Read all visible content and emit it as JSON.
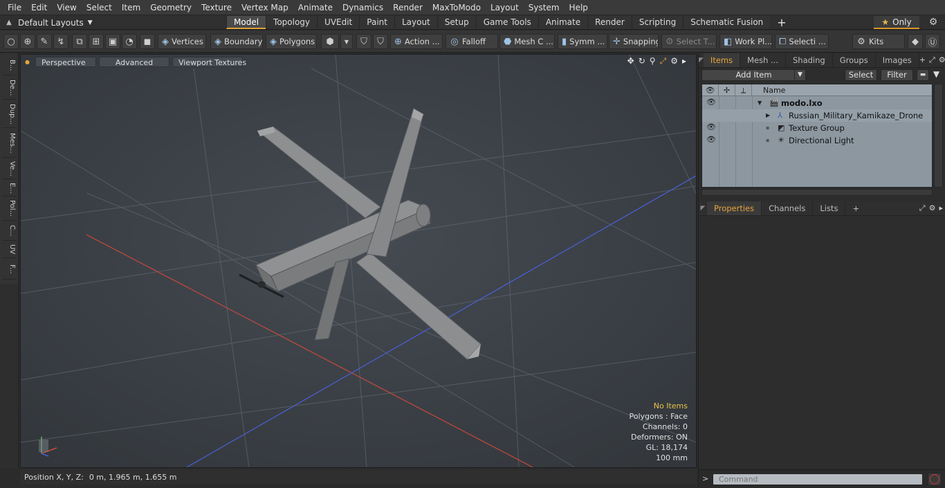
{
  "menu": [
    "File",
    "Edit",
    "View",
    "Select",
    "Item",
    "Geometry",
    "Texture",
    "Vertex Map",
    "Animate",
    "Dynamics",
    "Render",
    "MaxToModo",
    "Layout",
    "System",
    "Help"
  ],
  "layouts_dropdown": "Default Layouts",
  "layout_tabs": [
    "Model",
    "Topology",
    "UVEdit",
    "Paint",
    "Layout",
    "Setup",
    "Game Tools",
    "Animate",
    "Render",
    "Scripting",
    "Schematic Fusion"
  ],
  "active_layout_tab": "Model",
  "only_label": "Only",
  "toolbar": {
    "vertices": "Vertices",
    "boundary": "Boundary",
    "polygons": "Polygons",
    "action": "Action ...",
    "falloff": "Falloff",
    "mesh_c": "Mesh C ...",
    "symm": "Symm ...",
    "snapping": "Snapping",
    "select_t": "Select T...",
    "work_pl": "Work Pl...",
    "selecti": "Selecti ...",
    "kits": "Kits"
  },
  "left_tabs": [
    "B...",
    "De...",
    "Dup...",
    "Mes...",
    "Ve...",
    "E...",
    "Pol...",
    "C...",
    "UV",
    "F..."
  ],
  "viewport": {
    "perspective": "Perspective",
    "advanced": "Advanced",
    "viewport_textures": "Viewport Textures",
    "info": {
      "selection": "No Items",
      "polygons": "Polygons : Face",
      "channels": "Channels: 0",
      "deformers": "Deformers: ON",
      "gl": "GL: 18,174",
      "grid": "100 mm"
    }
  },
  "status": {
    "label": "Position X, Y, Z:",
    "value": "0 m, 1.965 m, 1.655 m"
  },
  "right_tabs_top": [
    "Items",
    "Mesh ...",
    "Shading",
    "Groups",
    "Images"
  ],
  "items_toolbar": {
    "add_item": "Add Item",
    "select": "Select",
    "filter": "Filter"
  },
  "item_list": {
    "name_header": "Name",
    "rows": [
      {
        "label": "modo.lxo"
      },
      {
        "label": "Russian_Military_Kamikaze_Drone"
      },
      {
        "label": "Texture Group"
      },
      {
        "label": "Directional Light"
      }
    ]
  },
  "right_tabs_bottom": [
    "Properties",
    "Channels",
    "Lists"
  ],
  "command_placeholder": "Command",
  "colors": {
    "accent": "#e0a43a",
    "viewport_bg": "#3b4046",
    "x_axis": "#c8483c",
    "z_axis": "#4a5fd8",
    "grid": "#6a737b"
  }
}
